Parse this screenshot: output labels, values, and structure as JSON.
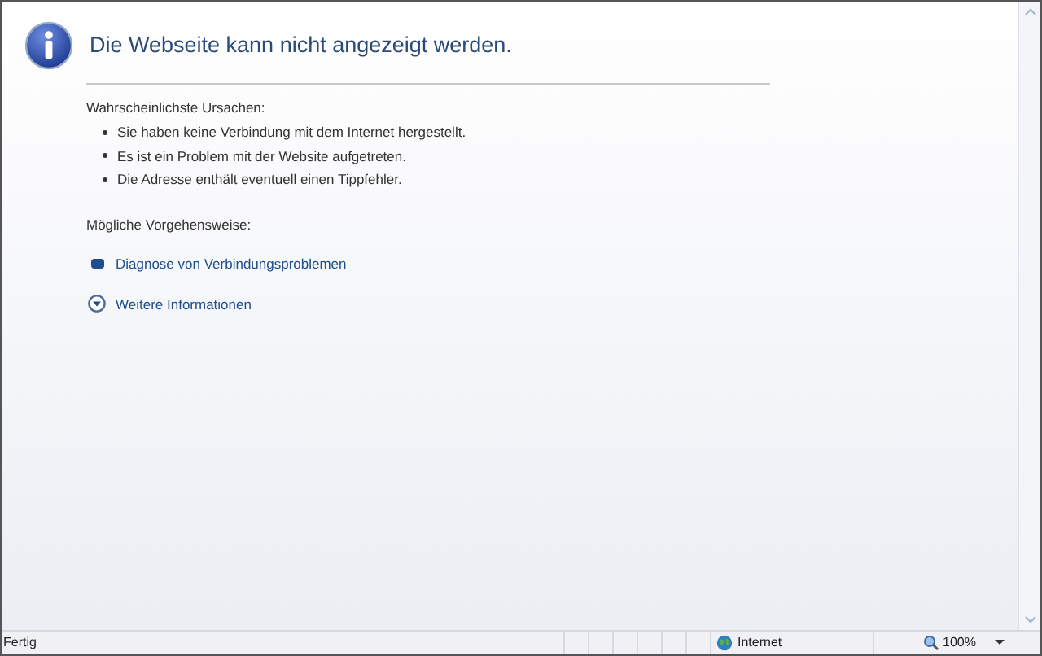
{
  "error_page": {
    "title": "Die Webseite kann nicht angezeigt werden.",
    "causes_heading": "Wahrscheinlichste Ursachen:",
    "causes": [
      "Sie haben keine Verbindung mit dem Internet hergestellt.",
      "Es ist ein Problem mit der Website aufgetreten.",
      "Die Adresse enthält eventuell einen Tippfehler."
    ],
    "actions_heading": "Mögliche Vorgehensweise:",
    "actions": [
      {
        "label": "Diagnose von Verbindungsproblemen",
        "kind": "bullet"
      },
      {
        "label": "Weitere Informationen",
        "kind": "expand"
      }
    ]
  },
  "status_bar": {
    "status": "Fertig",
    "zone": "Internet",
    "zoom": "100%"
  }
}
